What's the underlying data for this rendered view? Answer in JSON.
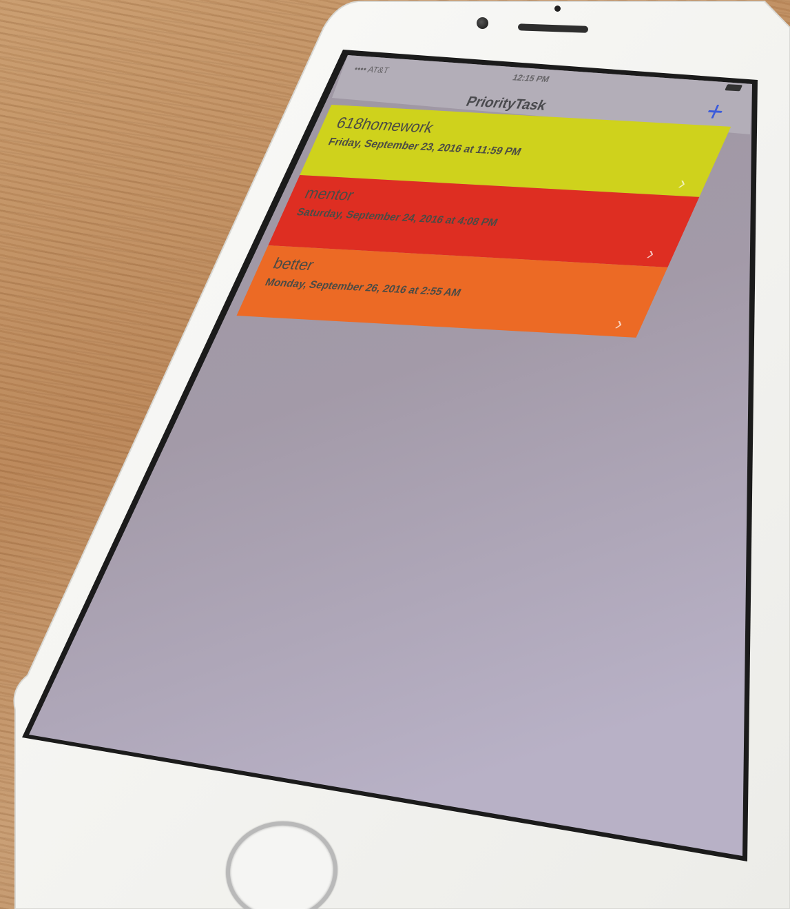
{
  "status_bar": {
    "carrier": "•••• AT&T ",
    "time": "12:15 PM",
    "battery_icon": "battery-icon"
  },
  "nav": {
    "title": "PriorityTask",
    "add_label": "+"
  },
  "tasks": [
    {
      "title": "618homework",
      "date": "Friday, September 23, 2016 at 11:59 PM",
      "color": "#cfd21c"
    },
    {
      "title": "mentor",
      "date": "Saturday, September 24, 2016 at 4:08 PM",
      "color": "#de2e22"
    },
    {
      "title": "better",
      "date": "Monday, September 26, 2016 at 2:55 AM",
      "color": "#ec6a25"
    }
  ],
  "chevron_glyph": "›",
  "colors": {
    "screen_background": "#a49ca8",
    "nav_background": "#b3aeb8",
    "accent": "#3b5bdb"
  }
}
